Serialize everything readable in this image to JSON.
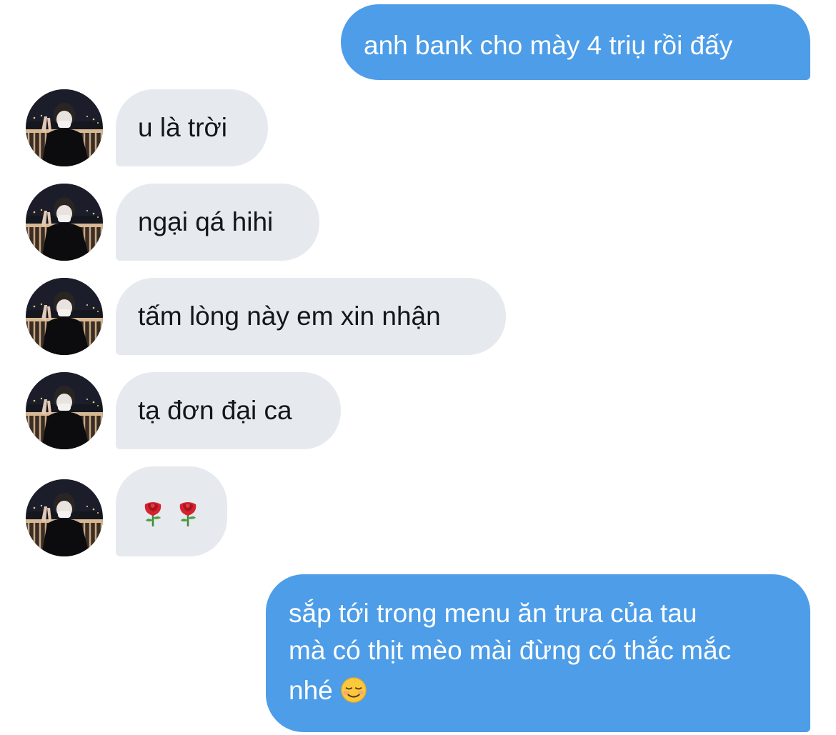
{
  "messages": [
    {
      "sender": "me",
      "text": "anh bank cho mày 4 triụ rồi đấy"
    },
    {
      "sender": "them",
      "text": "u là trời"
    },
    {
      "sender": "them",
      "text": "ngại qá hihi"
    },
    {
      "sender": "them",
      "text": "tấm lòng này em xin nhận"
    },
    {
      "sender": "them",
      "text": "tạ đơn đại ca"
    },
    {
      "sender": "them",
      "text": "",
      "emoji": [
        "rose-icon",
        "rose-icon"
      ]
    },
    {
      "sender": "me",
      "lines": [
        "sắp tới trong menu ăn trưa của tau",
        "mà có thịt mèo mài đừng có thắc mắc",
        "nhé"
      ],
      "emoji": "smiling-face-icon"
    }
  ],
  "colors": {
    "outgoing_bubble": "#4d9de8",
    "incoming_bubble": "#e6e9ee",
    "incoming_text": "#14171a"
  }
}
